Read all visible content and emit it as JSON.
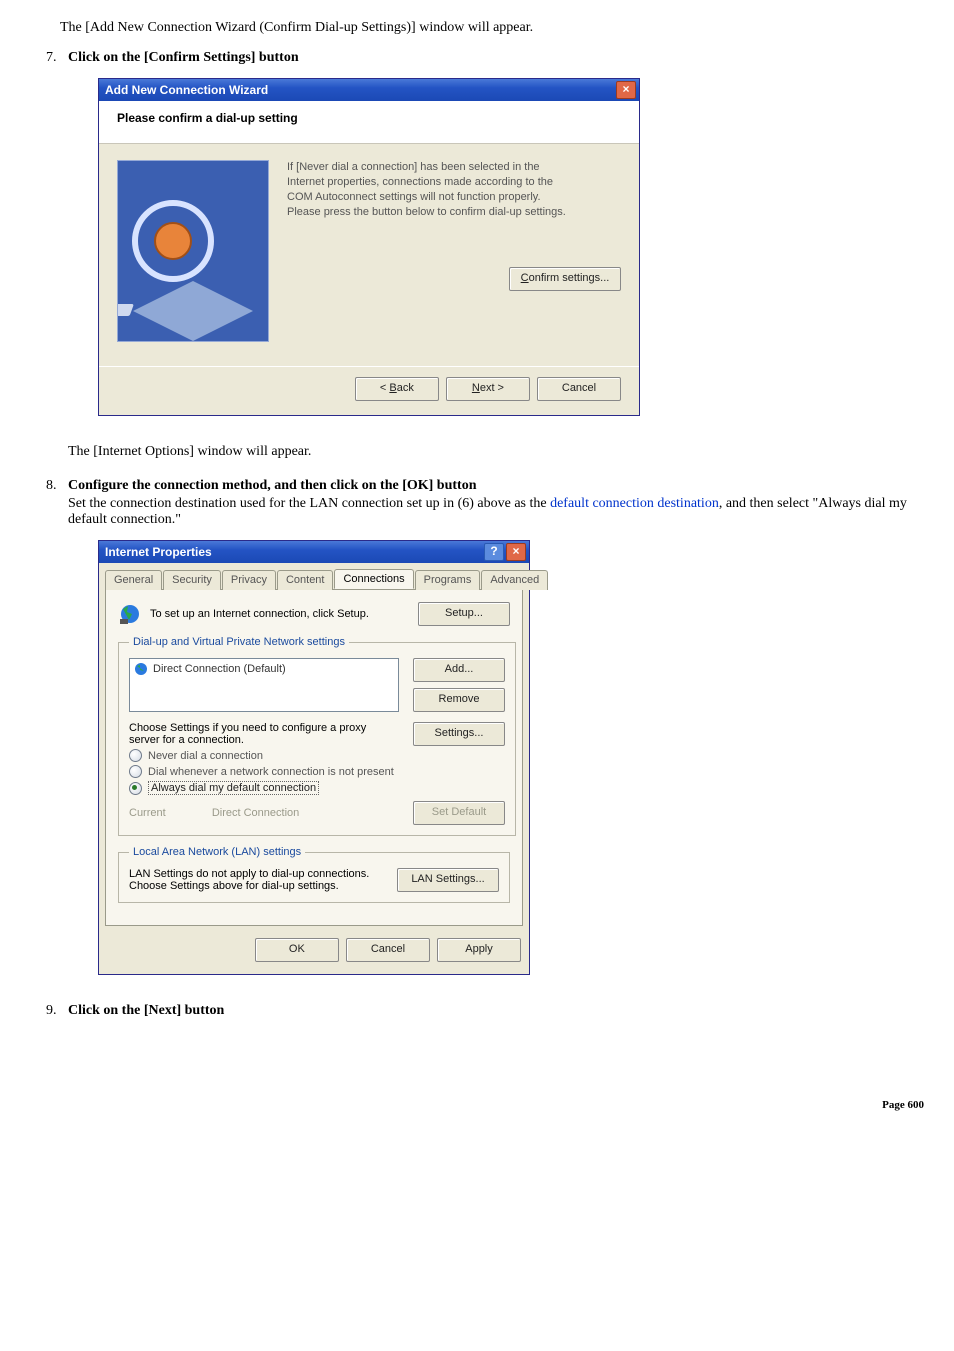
{
  "intro_text": "The [Add New Connection Wizard (Confirm Dial-up Settings)] window will appear.",
  "step7": {
    "num": "7.",
    "title": "Click on the [Confirm Settings] button"
  },
  "wizard": {
    "title": "Add New Connection Wizard",
    "subtitle": "Please confirm a dial-up setting",
    "body_l1": "If [Never dial a connection] has been selected in the",
    "body_l2": "Internet properties, connections made according to the",
    "body_l3": "COM Autoconnect settings will not function properly.",
    "body_l4": "Please press the button below to confirm dial-up settings.",
    "confirm_btn_pre": "C",
    "confirm_btn_rest": "onfirm settings...",
    "back_pre": "< ",
    "back_u": "B",
    "back_rest": "ack",
    "next_u": "N",
    "next_rest": "ext >",
    "cancel": "Cancel"
  },
  "mid_text": "The [Internet Options] window will appear.",
  "step8": {
    "num": "8.",
    "title": "Configure the connection method, and then click on the [OK] button",
    "desc_pre": "Set the connection destination used for the LAN connection set up in (6) above as the ",
    "desc_link": "default connection destination",
    "desc_post": ", and then select \"Always dial my default connection.\""
  },
  "ip": {
    "title": "Internet Properties",
    "tabs": {
      "general": "General",
      "security": "Security",
      "privacy": "Privacy",
      "content": "Content",
      "connections": "Connections",
      "programs": "Programs",
      "advanced": "Advanced"
    },
    "setup_text": "To set up an Internet connection, click Setup.",
    "setup_btn": "Setup...",
    "fs1_legend": "Dial-up and Virtual Private Network settings",
    "conn_item": "Direct Connection (Default)",
    "add_btn": "Add...",
    "remove_btn": "Remove",
    "settings_hint": "Choose Settings if you need to configure a proxy server for a connection.",
    "settings_btn": "Settings...",
    "radio_never": "Never dial a connection",
    "radio_when": "Dial whenever a network connection is not present",
    "radio_always": "Always dial my default connection",
    "current_label": "Current",
    "current_value": "Direct Connection",
    "setdefault_btn": "Set Default",
    "fs2_legend": "Local Area Network (LAN) settings",
    "lan_hint": "LAN Settings do not apply to dial-up connections. Choose Settings above for dial-up settings.",
    "lan_btn": "LAN Settings...",
    "ok": "OK",
    "cancel": "Cancel",
    "apply": "Apply"
  },
  "step9": {
    "num": "9.",
    "title": "Click on the [Next] button"
  },
  "page_num_label": "Page",
  "page_num_value": "600"
}
